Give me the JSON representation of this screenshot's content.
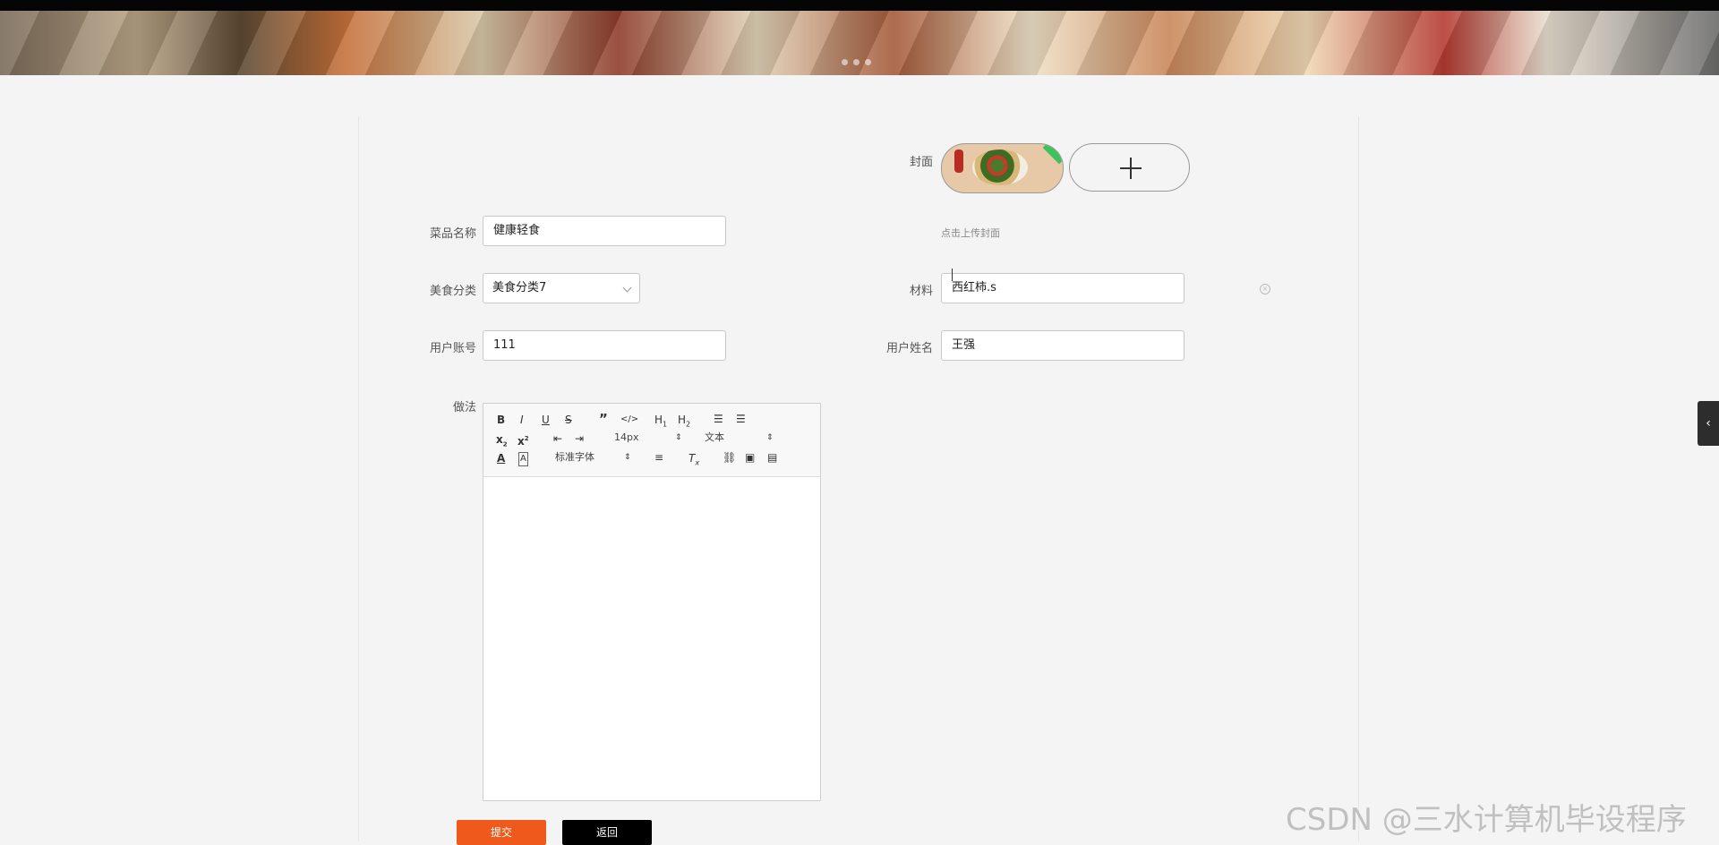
{
  "form": {
    "cover_label": "封面",
    "cover_hint": "点击上传封面",
    "dish_name_label": "菜品名称",
    "dish_name_value": "健康轻食",
    "category_label": "美食分类",
    "category_value": "美食分类7",
    "ingredients_label": "材料",
    "ingredients_value": "西红柿.s",
    "account_label": "用户账号",
    "account_value": "111",
    "username_label": "用户姓名",
    "username_value": "王强",
    "method_label": "做法"
  },
  "editor": {
    "font_size": "14px",
    "paragraph": "文本",
    "font_family": "标准字体",
    "icons": [
      "bold-icon",
      "italic-icon",
      "underline-icon",
      "strike-icon",
      "quote-icon",
      "code-icon",
      "h1-icon",
      "h2-icon",
      "ordered-list-icon",
      "bullet-list-icon",
      "subscript-icon",
      "superscript-icon",
      "outdent-icon",
      "indent-icon",
      "font-color-icon",
      "background-color-icon",
      "align-icon",
      "clear-format-icon",
      "link-icon",
      "image-icon",
      "video-icon"
    ]
  },
  "buttons": {
    "submit": "提交",
    "back": "返回"
  },
  "watermark": "CSDN @三水计算机毕设程序"
}
